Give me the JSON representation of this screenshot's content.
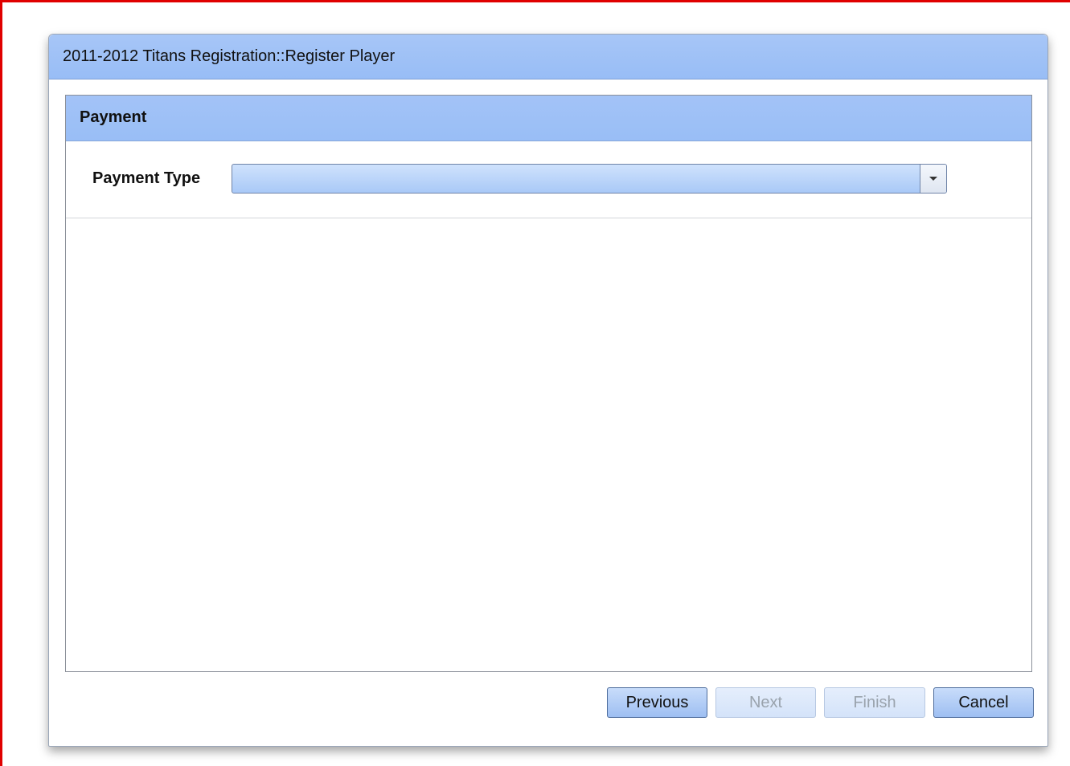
{
  "dialog": {
    "title": "2011-2012 Titans Registration::Register Player"
  },
  "panel": {
    "title": "Payment",
    "fields": {
      "payment_type": {
        "label": "Payment Type",
        "value": ""
      }
    }
  },
  "buttons": {
    "previous": {
      "label": "Previous",
      "enabled": true
    },
    "next": {
      "label": "Next",
      "enabled": false
    },
    "finish": {
      "label": "Finish",
      "enabled": false
    },
    "cancel": {
      "label": "Cancel",
      "enabled": true
    }
  },
  "colors": {
    "frame_border": "#e00000",
    "header_blue": "#a3c3f7",
    "button_blue": "#9ebff2"
  },
  "icons": {
    "combo_arrow": "chevron-down-icon"
  }
}
